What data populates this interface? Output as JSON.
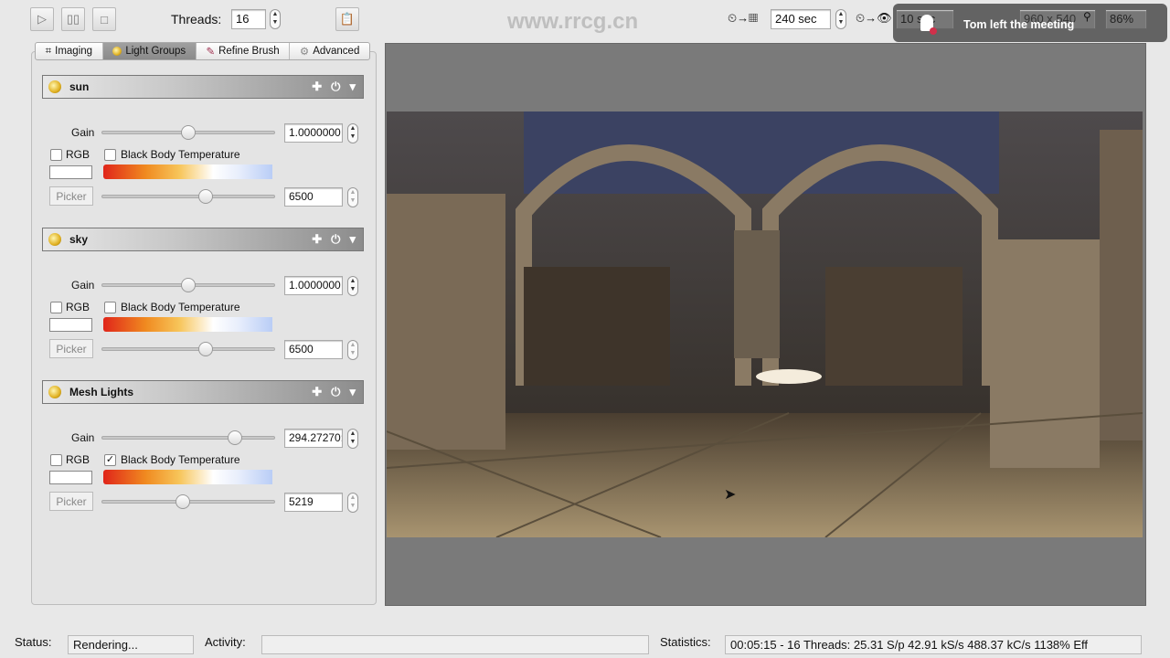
{
  "toolbar": {
    "threads_label": "Threads:",
    "threads_value": "16",
    "halt_time": "240 sec",
    "preview_time": "10 sec",
    "resolution": "960 x 540",
    "zoom": "86%"
  },
  "notification": {
    "text": "Tom left the meeting"
  },
  "tabs": [
    {
      "label": "Imaging",
      "icon": "crop-icon"
    },
    {
      "label": "Light Groups",
      "icon": "bulb-icon"
    },
    {
      "label": "Refine Brush",
      "icon": "brush-icon"
    },
    {
      "label": "Advanced",
      "icon": "gear-icon"
    }
  ],
  "labels": {
    "gain": "Gain",
    "rgb": "RGB",
    "bbt": "Black Body Temperature",
    "picker": "Picker"
  },
  "groups": [
    {
      "name": "sun",
      "gain": "1.0000000",
      "gain_frac": 0.5,
      "temp": "6500",
      "temp_frac": 0.6,
      "bbt_checked": false
    },
    {
      "name": "sky",
      "gain": "1.0000000",
      "gain_frac": 0.5,
      "temp": "6500",
      "temp_frac": 0.6,
      "bbt_checked": false
    },
    {
      "name": "Mesh Lights",
      "gain": "294.27270:",
      "gain_frac": 0.77,
      "temp": "5219",
      "temp_frac": 0.47,
      "bbt_checked": true
    }
  ],
  "statusbar": {
    "status_label": "Status:",
    "status": "Rendering...",
    "activity_label": "Activity:",
    "statistics_label": "Statistics:",
    "statistics": "00:05:15 - 16 Threads: 25.31 S/p 42.91 kS/s 488.37 kC/s 1138% Eff"
  },
  "watermark": "www.rrcg.cn"
}
